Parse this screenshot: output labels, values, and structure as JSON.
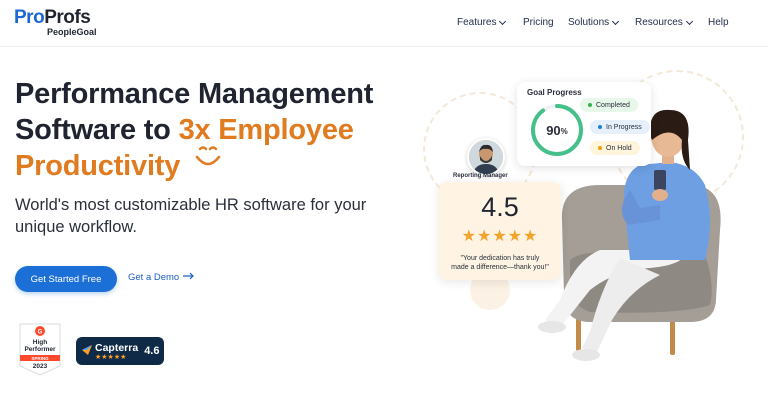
{
  "brand": {
    "logo_part1": "Pro",
    "logo_part2": "Profs",
    "logo_sub": "PeopleGoal"
  },
  "nav": {
    "items": [
      {
        "label": "Features",
        "has_dropdown": true
      },
      {
        "label": "Pricing",
        "has_dropdown": false
      },
      {
        "label": "Solutions",
        "has_dropdown": true
      },
      {
        "label": "Resources",
        "has_dropdown": true
      },
      {
        "label": "Help",
        "has_dropdown": false
      }
    ]
  },
  "hero": {
    "title_line1": "Performance Management",
    "title_line2_prefix": "Software to ",
    "title_line2_accent": "3x Employee",
    "title_line3_accent": "Productivity",
    "subtitle_line1": "World's most customizable HR software for your",
    "subtitle_line2": "unique workflow.",
    "primary_cta": "Get Started Free",
    "secondary_cta": "Get a Demo",
    "secondary_cta_icon": "arrow-right-icon"
  },
  "badges": {
    "g2": {
      "line1": "High",
      "line2": "Performer",
      "season": "SPRING",
      "year": "2023"
    },
    "capterra": {
      "name": "Capterra",
      "rating": "4.6",
      "stars": "★★★★★"
    }
  },
  "goal_progress": {
    "title": "Goal Progress",
    "percent": "90",
    "percent_unit": "%",
    "progress_value": 0.9,
    "statuses": [
      {
        "label": "Completed",
        "color": "#37b24d",
        "bg": "#e7f7ea"
      },
      {
        "label": "In Progress",
        "color": "#1c7ed6",
        "bg": "#e5f0fc"
      },
      {
        "label": "On Hold",
        "color": "#f59f00",
        "bg": "#fff4dc"
      }
    ]
  },
  "manager": {
    "label": "Reporting Manager"
  },
  "rating_card": {
    "value": "4.5",
    "stars": "★★★★★",
    "quote_line1": "\"Your dedication has truly",
    "quote_line2": "made a difference—thank you!\""
  },
  "colors": {
    "brand_blue": "#1c6fd6",
    "accent_orange": "#e07b1f",
    "star": "#f3a32a"
  }
}
